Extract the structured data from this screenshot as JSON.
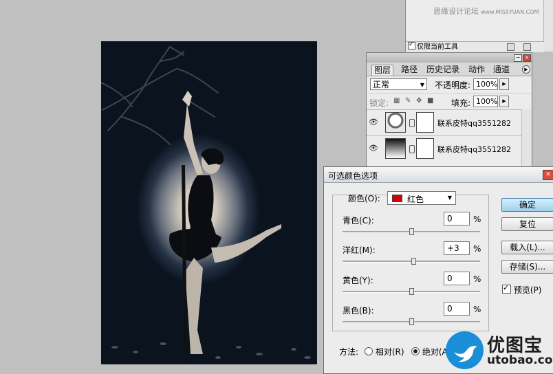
{
  "watermark": {
    "text": "思缘设计论坛",
    "url": "www.MISSYUAN.COM"
  },
  "tool_panel": {
    "only_current_tool": "仅限当前工具"
  },
  "layers_panel": {
    "tabs": [
      "图层",
      "路径",
      "历史记录",
      "动作",
      "通道"
    ],
    "blend_mode": "正常",
    "opacity_label": "不透明度:",
    "opacity": "100%",
    "lock_label": "锁定:",
    "fill_label": "填充:",
    "fill": "100%",
    "layers": [
      {
        "name": "联系皮特qq3551282"
      },
      {
        "name": "联系皮特qq3551282"
      }
    ]
  },
  "dialog": {
    "title": "可选颜色选项",
    "colors_label": "颜色(O):",
    "colors_value": "红色",
    "sliders": [
      {
        "label": "青色(C):",
        "value": "0",
        "pos": 0.5
      },
      {
        "label": "洋红(M):",
        "value": "+3",
        "pos": 0.515
      },
      {
        "label": "黄色(Y):",
        "value": "0",
        "pos": 0.5
      },
      {
        "label": "黑色(B):",
        "value": "0",
        "pos": 0.5
      }
    ],
    "percent": "%",
    "buttons": {
      "ok": "确定",
      "reset": "复位",
      "load": "载入(L)...",
      "save": "存储(S)..."
    },
    "preview_label": "预览(P)",
    "method_label": "方法:",
    "relative_label": "相对(R)",
    "absolute_label": "绝对(A)"
  },
  "logo": {
    "brand": "优图宝",
    "domain": "utobao.com"
  },
  "colors": {
    "accent": "#1a8ed7",
    "swatch_red": "#d40000"
  }
}
